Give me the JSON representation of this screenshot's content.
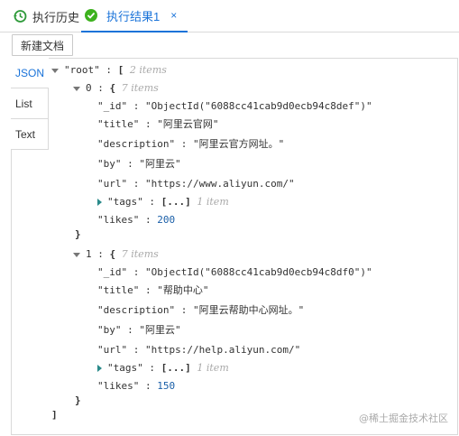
{
  "tabs": {
    "history_label": "执行历史",
    "result_label": "执行结果1",
    "close_glyph": "×"
  },
  "toolbar": {
    "new_doc_label": "新建文档"
  },
  "view_tabs": [
    "JSON",
    "List",
    "Text"
  ],
  "tree": {
    "root_key": "\"root\"",
    "open_bracket": "[",
    "close_bracket": "]",
    "root_count": "2 items",
    "colon": ":",
    "docs": [
      {
        "index": "0",
        "count": "7 items",
        "fields": [
          {
            "key": "\"_id\"",
            "value": "\"ObjectId(\"6088cc41cab9d0ecb94c8def\")\""
          },
          {
            "key": "\"title\"",
            "value": "\"阿里云官网\""
          },
          {
            "key": "\"description\"",
            "value": "\"阿里云官方网址。\""
          },
          {
            "key": "\"by\"",
            "value": "\"阿里云\""
          },
          {
            "key": "\"url\"",
            "value": "\"https://www.aliyun.com/\""
          },
          {
            "key": "\"tags\"",
            "value": "[...]",
            "meta": "1 item"
          },
          {
            "key": "\"likes\"",
            "value": "200"
          }
        ]
      },
      {
        "index": "1",
        "count": "7 items",
        "fields": [
          {
            "key": "\"_id\"",
            "value": "\"ObjectId(\"6088cc41cab9d0ecb94c8df0\")\""
          },
          {
            "key": "\"title\"",
            "value": "\"帮助中心\""
          },
          {
            "key": "\"description\"",
            "value": "\"阿里云帮助中心网址。\""
          },
          {
            "key": "\"by\"",
            "value": "\"阿里云\""
          },
          {
            "key": "\"url\"",
            "value": "\"https://help.aliyun.com/\""
          },
          {
            "key": "\"tags\"",
            "value": "[...]",
            "meta": "1 item"
          },
          {
            "key": "\"likes\"",
            "value": "150"
          }
        ]
      }
    ]
  },
  "watermark": "@稀土掘金技术社区"
}
